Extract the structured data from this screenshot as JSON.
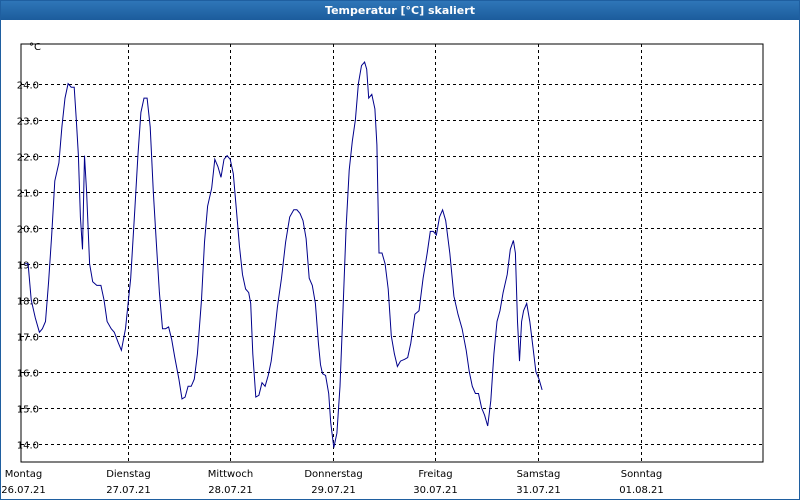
{
  "window": {
    "title": "Temperatur [°C] skaliert"
  },
  "chart_data": {
    "type": "line",
    "title": "Temperatur [°C] skaliert",
    "ylabel": "°C",
    "ylim": [
      13.5,
      25.1
    ],
    "xlim": [
      0,
      7
    ],
    "yticks": [
      14.0,
      15.0,
      16.0,
      17.0,
      18.0,
      19.0,
      20.0,
      21.0,
      22.0,
      23.0,
      24.0
    ],
    "grid": true,
    "colors": {
      "series": "#00008b",
      "grid": "#000000",
      "background": "#ffffff"
    },
    "xticks": [
      {
        "x": 0,
        "day": "Montag",
        "date": "26.07.21"
      },
      {
        "x": 1,
        "day": "Dienstag",
        "date": "27.07.21"
      },
      {
        "x": 2,
        "day": "Mittwoch",
        "date": "28.07.21"
      },
      {
        "x": 3,
        "day": "Donnerstag",
        "date": "29.07.21"
      },
      {
        "x": 4,
        "day": "Freitag",
        "date": "30.07.21"
      },
      {
        "x": 5,
        "day": "Samstag",
        "date": "31.07.21"
      },
      {
        "x": 6,
        "day": "Sonntag",
        "date": "01.08.21"
      }
    ],
    "series": [
      {
        "points": [
          [
            0.0,
            19.0
          ],
          [
            0.03,
            19.0
          ],
          [
            0.06,
            18.0
          ],
          [
            0.1,
            17.5
          ],
          [
            0.14,
            17.1
          ],
          [
            0.17,
            17.2
          ],
          [
            0.2,
            17.4
          ],
          [
            0.23,
            18.5
          ],
          [
            0.26,
            19.8
          ],
          [
            0.29,
            21.3
          ],
          [
            0.33,
            21.8
          ],
          [
            0.36,
            22.8
          ],
          [
            0.39,
            23.6
          ],
          [
            0.42,
            24.0
          ],
          [
            0.45,
            23.9
          ],
          [
            0.48,
            23.9
          ],
          [
            0.5,
            23.0
          ],
          [
            0.52,
            22.0
          ],
          [
            0.54,
            20.3
          ],
          [
            0.56,
            19.4
          ],
          [
            0.58,
            22.0
          ],
          [
            0.6,
            21.0
          ],
          [
            0.63,
            19.0
          ],
          [
            0.66,
            18.5
          ],
          [
            0.7,
            18.4
          ],
          [
            0.74,
            18.4
          ],
          [
            0.77,
            18.0
          ],
          [
            0.8,
            17.4
          ],
          [
            0.84,
            17.2
          ],
          [
            0.87,
            17.1
          ],
          [
            0.91,
            16.8
          ],
          [
            0.94,
            16.6
          ],
          [
            0.98,
            17.2
          ],
          [
            1.03,
            18.6
          ],
          [
            1.07,
            20.5
          ],
          [
            1.1,
            22.0
          ],
          [
            1.13,
            23.2
          ],
          [
            1.16,
            23.6
          ],
          [
            1.19,
            23.6
          ],
          [
            1.22,
            22.8
          ],
          [
            1.25,
            21.0
          ],
          [
            1.28,
            19.6
          ],
          [
            1.31,
            18.2
          ],
          [
            1.34,
            17.2
          ],
          [
            1.37,
            17.2
          ],
          [
            1.4,
            17.25
          ],
          [
            1.43,
            16.9
          ],
          [
            1.46,
            16.4
          ],
          [
            1.5,
            15.8
          ],
          [
            1.53,
            15.25
          ],
          [
            1.56,
            15.3
          ],
          [
            1.59,
            15.6
          ],
          [
            1.62,
            15.6
          ],
          [
            1.65,
            15.8
          ],
          [
            1.68,
            16.5
          ],
          [
            1.72,
            18.0
          ],
          [
            1.75,
            19.6
          ],
          [
            1.78,
            20.6
          ],
          [
            1.82,
            21.1
          ],
          [
            1.85,
            21.9
          ],
          [
            1.88,
            21.7
          ],
          [
            1.91,
            21.4
          ],
          [
            1.94,
            21.9
          ],
          [
            1.97,
            22.0
          ],
          [
            2.0,
            21.9
          ],
          [
            2.03,
            21.5
          ],
          [
            2.06,
            20.5
          ],
          [
            2.09,
            19.5
          ],
          [
            2.12,
            18.7
          ],
          [
            2.15,
            18.3
          ],
          [
            2.18,
            18.2
          ],
          [
            2.2,
            17.9
          ],
          [
            2.22,
            16.5
          ],
          [
            2.25,
            15.3
          ],
          [
            2.28,
            15.35
          ],
          [
            2.31,
            15.7
          ],
          [
            2.34,
            15.6
          ],
          [
            2.37,
            15.9
          ],
          [
            2.4,
            16.3
          ],
          [
            2.43,
            17.0
          ],
          [
            2.46,
            17.8
          ],
          [
            2.5,
            18.6
          ],
          [
            2.54,
            19.6
          ],
          [
            2.58,
            20.3
          ],
          [
            2.62,
            20.5
          ],
          [
            2.65,
            20.5
          ],
          [
            2.68,
            20.4
          ],
          [
            2.71,
            20.2
          ],
          [
            2.74,
            19.7
          ],
          [
            2.77,
            18.6
          ],
          [
            2.8,
            18.4
          ],
          [
            2.83,
            17.9
          ],
          [
            2.86,
            16.8
          ],
          [
            2.88,
            16.2
          ],
          [
            2.9,
            15.95
          ],
          [
            2.93,
            15.9
          ],
          [
            2.96,
            15.4
          ],
          [
            2.98,
            14.6
          ],
          [
            3.01,
            13.9
          ],
          [
            3.04,
            14.3
          ],
          [
            3.07,
            15.6
          ],
          [
            3.1,
            17.8
          ],
          [
            3.13,
            20.0
          ],
          [
            3.16,
            21.6
          ],
          [
            3.19,
            22.4
          ],
          [
            3.22,
            23.0
          ],
          [
            3.25,
            24.0
          ],
          [
            3.28,
            24.5
          ],
          [
            3.31,
            24.6
          ],
          [
            3.33,
            24.4
          ],
          [
            3.35,
            23.6
          ],
          [
            3.38,
            23.7
          ],
          [
            3.41,
            23.3
          ],
          [
            3.43,
            22.3
          ],
          [
            3.45,
            19.3
          ],
          [
            3.48,
            19.3
          ],
          [
            3.51,
            19.0
          ],
          [
            3.54,
            18.3
          ],
          [
            3.57,
            17.0
          ],
          [
            3.6,
            16.5
          ],
          [
            3.63,
            16.15
          ],
          [
            3.66,
            16.3
          ],
          [
            3.7,
            16.35
          ],
          [
            3.73,
            16.4
          ],
          [
            3.76,
            16.8
          ],
          [
            3.8,
            17.6
          ],
          [
            3.84,
            17.7
          ],
          [
            3.88,
            18.6
          ],
          [
            3.92,
            19.3
          ],
          [
            3.95,
            19.9
          ],
          [
            3.98,
            19.9
          ],
          [
            4.01,
            19.8
          ],
          [
            4.04,
            20.3
          ],
          [
            4.07,
            20.5
          ],
          [
            4.1,
            20.2
          ],
          [
            4.14,
            19.3
          ],
          [
            4.18,
            18.1
          ],
          [
            4.22,
            17.6
          ],
          [
            4.26,
            17.2
          ],
          [
            4.3,
            16.6
          ],
          [
            4.33,
            16.0
          ],
          [
            4.36,
            15.6
          ],
          [
            4.39,
            15.4
          ],
          [
            4.42,
            15.4
          ],
          [
            4.45,
            15.0
          ],
          [
            4.48,
            14.8
          ],
          [
            4.51,
            14.5
          ],
          [
            4.54,
            15.2
          ],
          [
            4.57,
            16.5
          ],
          [
            4.6,
            17.4
          ],
          [
            4.63,
            17.7
          ],
          [
            4.66,
            18.2
          ],
          [
            4.7,
            18.7
          ],
          [
            4.73,
            19.4
          ],
          [
            4.76,
            19.65
          ],
          [
            4.78,
            19.3
          ],
          [
            4.8,
            17.4
          ],
          [
            4.82,
            16.3
          ],
          [
            4.84,
            17.4
          ],
          [
            4.86,
            17.7
          ],
          [
            4.89,
            17.9
          ],
          [
            4.92,
            17.4
          ],
          [
            4.95,
            16.7
          ],
          [
            4.98,
            16.0
          ],
          [
            5.01,
            15.8
          ],
          [
            5.04,
            15.5
          ]
        ]
      }
    ]
  }
}
